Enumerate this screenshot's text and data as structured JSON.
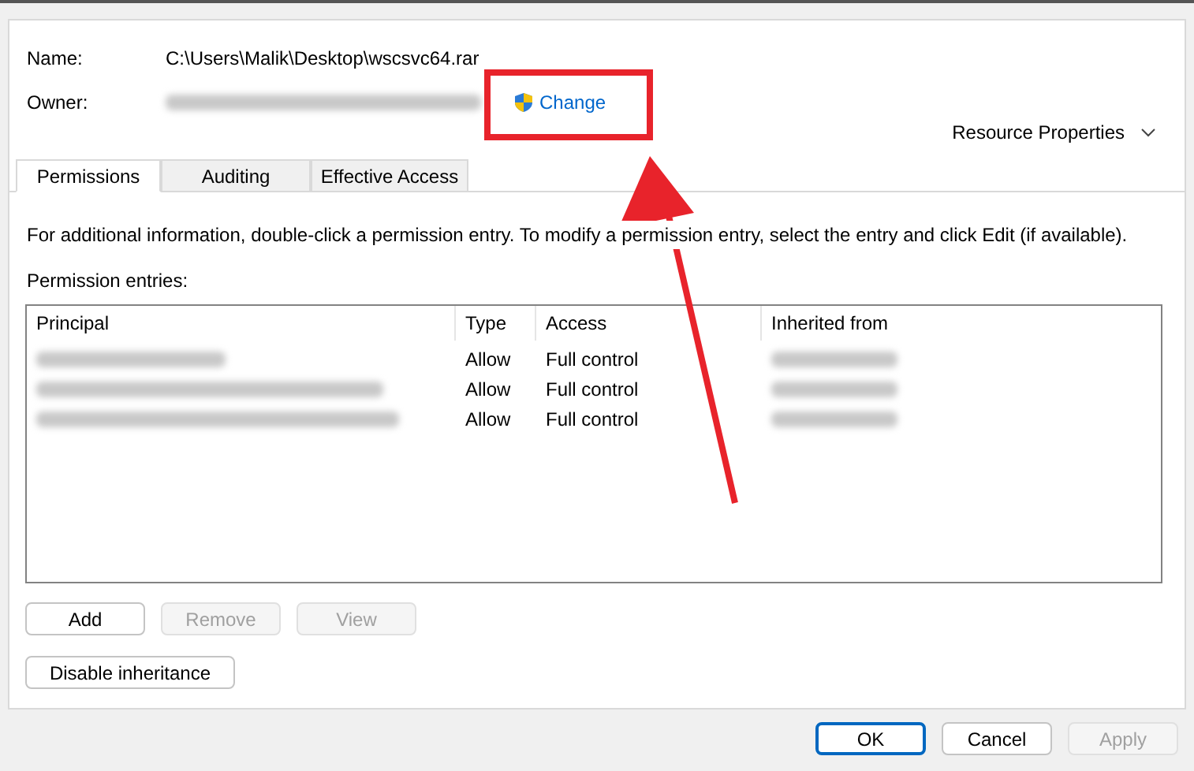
{
  "fields": [
    {
      "label": "Name:",
      "value": "C:\\Users\\Malik\\Desktop\\wscsvc64.rar",
      "kind": "text"
    },
    {
      "label": "Owner:",
      "kind": "redacted",
      "link": "Change"
    }
  ],
  "resource_properties": "Resource Properties",
  "tabs": [
    {
      "label": "Permissions",
      "selected": true
    },
    {
      "label": "Auditing",
      "selected": false
    },
    {
      "label": "Effective Access",
      "selected": false
    }
  ],
  "info": "For additional information, double-click a permission entry. To modify a permission entry, select the entry and click Edit (if available).",
  "entries_label": "Permission entries:",
  "table": {
    "columns": [
      "Principal",
      "Type",
      "Access",
      "Inherited from"
    ],
    "rows": [
      {
        "type": "Allow",
        "access": "Full control"
      },
      {
        "type": "Allow",
        "access": "Full control"
      },
      {
        "type": "Allow",
        "access": "Full control"
      }
    ]
  },
  "entry_buttons": [
    {
      "label": "Add",
      "disabled": false
    },
    {
      "label": "Remove",
      "disabled": true
    },
    {
      "label": "View",
      "disabled": true
    }
  ],
  "inheritance_button": "Disable inheritance",
  "dialog_buttons": [
    {
      "label": "OK",
      "disabled": false,
      "default": true
    },
    {
      "label": "Cancel",
      "disabled": false,
      "default": false
    },
    {
      "label": "Apply",
      "disabled": true,
      "default": false
    }
  ]
}
